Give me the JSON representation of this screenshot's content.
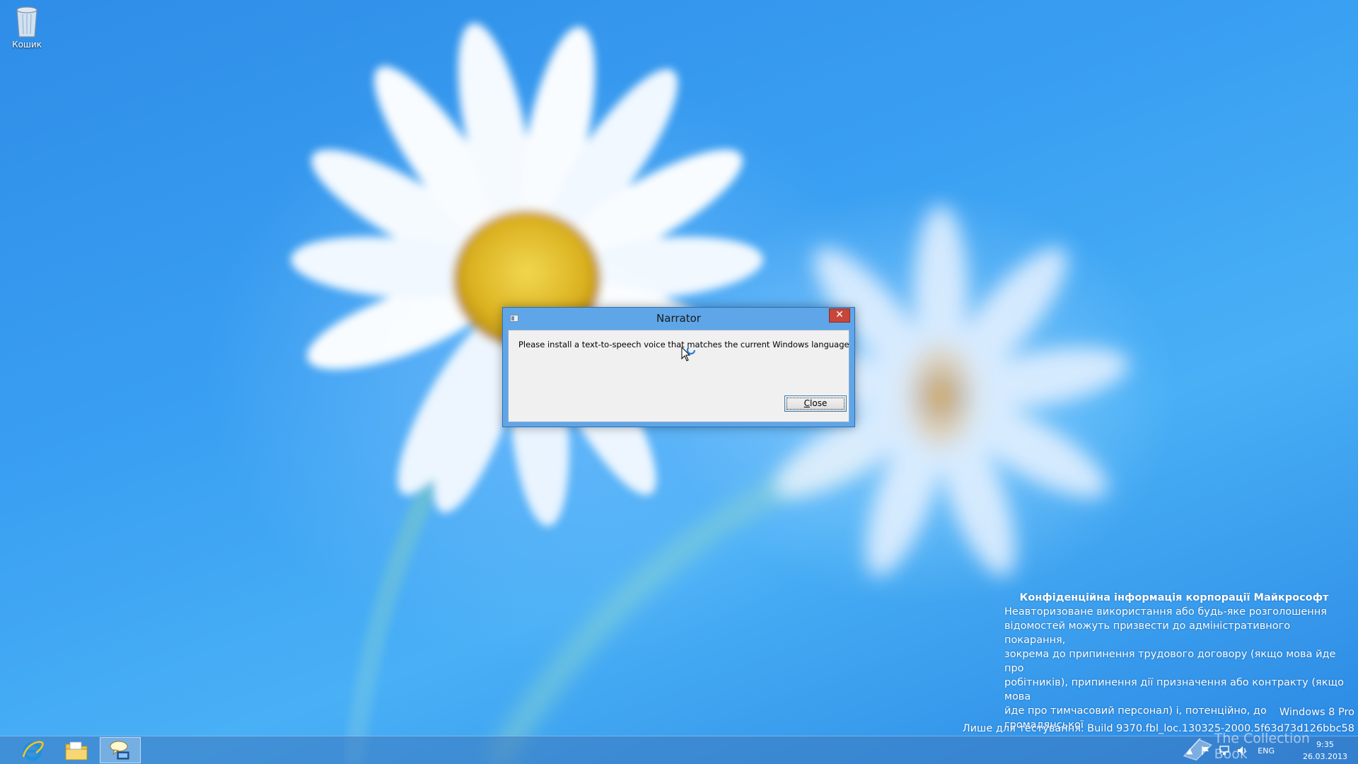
{
  "desktop": {
    "icons": [
      {
        "label": "Кошик",
        "icon": "recycle-bin-icon"
      }
    ]
  },
  "dialog": {
    "title": "Narrator",
    "close_glyph": "✕",
    "message": "Please install a text-to-speech voice that matches the current Windows language",
    "button_label_access_key": "C",
    "button_label_rest": "lose"
  },
  "watermark": {
    "title": "Конфіденційна інформація корпорації Майкрософт",
    "lines": [
      "Неавторизоване використання або будь-яке розголошення",
      "відомостей можуть призвести до адміністративного покарання,",
      "зокрема до припинення трудового договору (якщо мова йде про",
      "робітників), припинення дії призначення або контракту (якщо мова",
      "йде про тимчасовий персонал) і, потенційно, до громадянської"
    ],
    "edition": "Windows 8 Pro",
    "build": "Лише для тестування. Build 9370.fbl_loc.130325-2000.5f63d73d126bbc58"
  },
  "taskbar": {
    "pinned": [
      {
        "name": "Internet Explorer",
        "icon": "internet-explorer-icon",
        "active": false
      },
      {
        "name": "File Explorer",
        "icon": "file-explorer-icon",
        "active": false
      },
      {
        "name": "Narrator",
        "icon": "narrator-icon",
        "active": true
      }
    ],
    "tray": {
      "chevron": "▲",
      "language": "ENG",
      "time": "9:35",
      "date": "26.03.2013"
    }
  },
  "overlay": {
    "brand_text": "The Collection Book"
  },
  "colors": {
    "dialog_frame": "#5fa6e8",
    "close_button": "#c7463a",
    "taskbar": "#3c78be"
  }
}
